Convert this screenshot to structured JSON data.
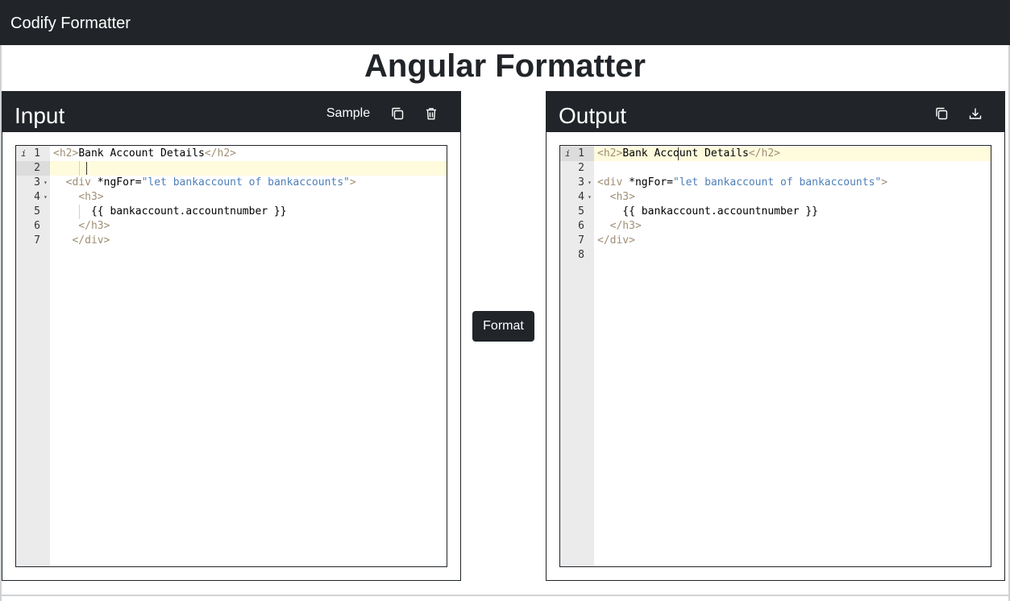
{
  "navbar": {
    "brand": "Codify Formatter"
  },
  "page": {
    "title": "Angular Formatter"
  },
  "input_panel": {
    "title": "Input",
    "sample_label": "Sample",
    "copy_icon": "copy-icon",
    "delete_icon": "trash-icon",
    "lines": [
      {
        "num": "1",
        "parts": [
          [
            "tag",
            "<h2>"
          ],
          [
            "text",
            "Bank Account Details"
          ],
          [
            "tag",
            "</h2>"
          ]
        ]
      },
      {
        "num": "2",
        "parts": []
      },
      {
        "num": "3",
        "parts": [
          [
            "text",
            "  "
          ],
          [
            "tag",
            "<div "
          ],
          [
            "attr",
            "*ngFor="
          ],
          [
            "str",
            "\"let bankaccount of bankaccounts\""
          ],
          [
            "tag",
            ">"
          ]
        ]
      },
      {
        "num": "4",
        "parts": [
          [
            "text",
            "    "
          ],
          [
            "tag",
            "<h3>"
          ]
        ]
      },
      {
        "num": "5",
        "parts": [
          [
            "text",
            "      {{ bankaccount.accountnumber }}"
          ]
        ]
      },
      {
        "num": "6",
        "parts": [
          [
            "text",
            "    "
          ],
          [
            "tag",
            "</h3>"
          ]
        ]
      },
      {
        "num": "7",
        "parts": [
          [
            "text",
            "   "
          ],
          [
            "tag",
            "</div>"
          ]
        ]
      }
    ]
  },
  "output_panel": {
    "title": "Output",
    "copy_icon": "copy-icon",
    "download_icon": "download-icon",
    "lines": [
      {
        "num": "1",
        "parts": [
          [
            "tag",
            "<h2>"
          ],
          [
            "text",
            "Bank Account Details"
          ],
          [
            "tag",
            "</h2>"
          ]
        ]
      },
      {
        "num": "2",
        "parts": []
      },
      {
        "num": "3",
        "parts": [
          [
            "tag",
            "<div "
          ],
          [
            "attr",
            "*ngFor="
          ],
          [
            "str",
            "\"let bankaccount of bankaccounts\""
          ],
          [
            "tag",
            ">"
          ]
        ]
      },
      {
        "num": "4",
        "parts": [
          [
            "text",
            "  "
          ],
          [
            "tag",
            "<h3>"
          ]
        ]
      },
      {
        "num": "5",
        "parts": [
          [
            "text",
            "    {{ bankaccount.accountnumber }}"
          ]
        ]
      },
      {
        "num": "6",
        "parts": [
          [
            "text",
            "  "
          ],
          [
            "tag",
            "</h3>"
          ]
        ]
      },
      {
        "num": "7",
        "parts": [
          [
            "tag",
            "</div>"
          ]
        ]
      },
      {
        "num": "8",
        "parts": []
      }
    ]
  },
  "actions": {
    "format_label": "Format"
  }
}
